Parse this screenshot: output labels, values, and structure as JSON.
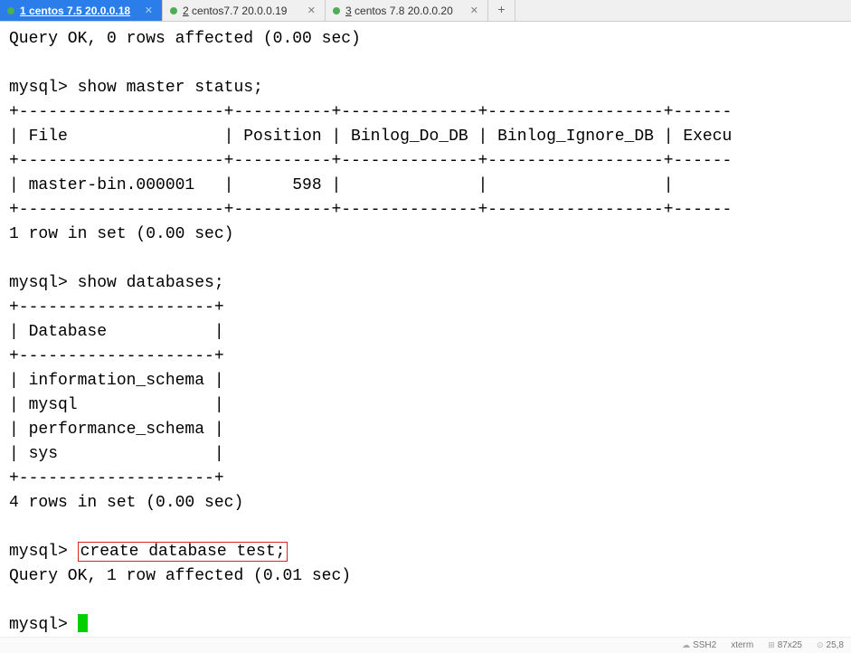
{
  "tabs": [
    {
      "num": "1",
      "label": "centos 7.5 20.0.0.18",
      "active": true
    },
    {
      "num": "2",
      "label": "centos7.7  20.0.0.19",
      "active": false
    },
    {
      "num": "3",
      "label": "centos 7.8 20.0.0.20",
      "active": false
    }
  ],
  "terminal": {
    "line_query_ok_0": "Query OK, 0 rows affected (0.00 sec)",
    "blank": "",
    "prompt": "mysql> ",
    "cmd_show_master": "show master status;",
    "master_table": {
      "border_top": "+---------------------+----------+--------------+------------------+------",
      "header": "| File                | Position | Binlog_Do_DB | Binlog_Ignore_DB | Execu",
      "border_mid": "+---------------------+----------+--------------+------------------+------",
      "row": "| master-bin.000001   |      598 |              |                  |",
      "border_bot": "+---------------------+----------+--------------+------------------+------"
    },
    "master_result": "1 row in set (0.00 sec)",
    "cmd_show_db": "show databases;",
    "db_table": {
      "border_top": "+--------------------+",
      "header": "| Database           |",
      "border_mid": "+--------------------+",
      "row1": "| information_schema |",
      "row2": "| mysql              |",
      "row3": "| performance_schema |",
      "row4": "| sys                |",
      "border_bot": "+--------------------+"
    },
    "db_result": "4 rows in set (0.00 sec)",
    "cmd_create_db": "create database test;",
    "create_result": "Query OK, 1 row affected (0.01 sec)"
  },
  "status": {
    "proto": "SSH2",
    "term": "xterm",
    "size": "87x25",
    "extra": "25,8"
  }
}
